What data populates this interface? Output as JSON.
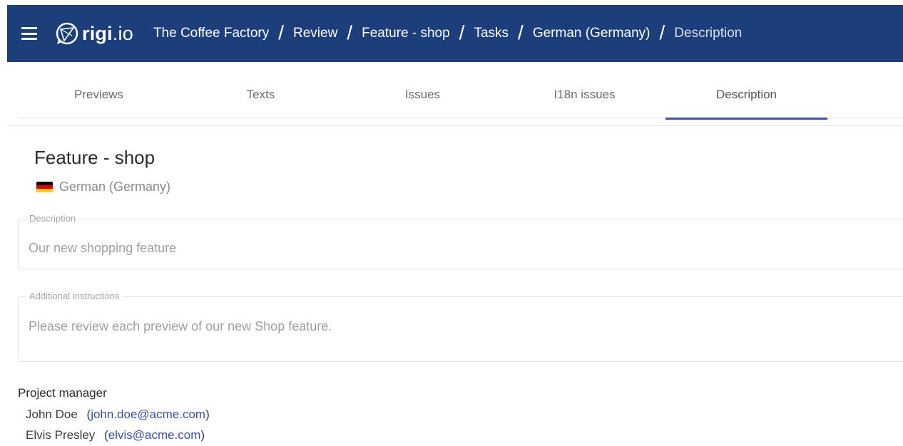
{
  "header": {
    "logo_text_bold": "rigi",
    "logo_text_suffix": ".io",
    "breadcrumbs": [
      "The Coffee Factory",
      "Review",
      "Feature - shop",
      "Tasks",
      "German (Germany)"
    ],
    "current": "Description",
    "separator": "/",
    "background_color": "#1c3f7c"
  },
  "tabs": [
    {
      "label": "Previews"
    },
    {
      "label": "Texts"
    },
    {
      "label": "Issues"
    },
    {
      "label": "I18n issues"
    },
    {
      "label": "Description",
      "active": true
    }
  ],
  "page": {
    "title": "Feature - shop",
    "language": "German (Germany)",
    "flag_colors": [
      "#000000",
      "#dd0000",
      "#ffce00"
    ]
  },
  "fields": {
    "description": {
      "label": "Description",
      "value": "Our new shopping feature"
    },
    "additional_instructions": {
      "label": "Additional instructions",
      "value": "Please review each preview of our new Shop feature."
    }
  },
  "project_manager": {
    "label": "Project manager",
    "people": [
      {
        "name": "John Doe",
        "email": "john.doe@acme.com"
      },
      {
        "name": "Elvis Presley",
        "email": "elvis@acme.com"
      }
    ]
  },
  "colors": {
    "accent": "#3b4fa3"
  }
}
